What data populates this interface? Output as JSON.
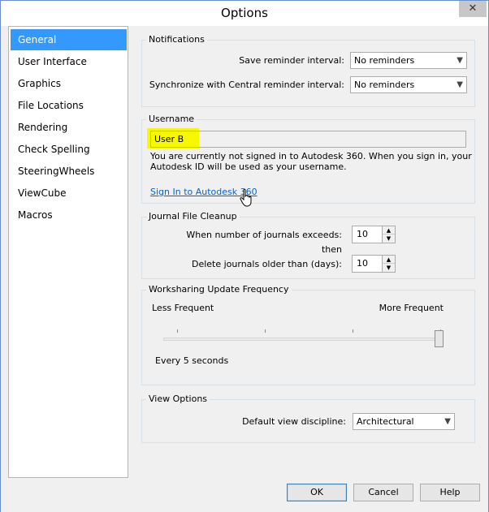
{
  "window": {
    "title": "Options",
    "close_glyph": "✕"
  },
  "sidebar": {
    "items": [
      {
        "label": "General",
        "selected": true
      },
      {
        "label": "User Interface"
      },
      {
        "label": "Graphics"
      },
      {
        "label": "File Locations"
      },
      {
        "label": "Rendering"
      },
      {
        "label": "Check Spelling"
      },
      {
        "label": "SteeringWheels"
      },
      {
        "label": "ViewCube"
      },
      {
        "label": "Macros"
      }
    ]
  },
  "notifications": {
    "title": "Notifications",
    "save_label": "Save reminder interval:",
    "save_value": "No reminders",
    "sync_label": "Synchronize with Central reminder interval:",
    "sync_value": "No reminders"
  },
  "username": {
    "title": "Username",
    "value": "User B",
    "info_line1": "You are currently not signed in to Autodesk 360. When you sign in, your",
    "info_line2": "Autodesk ID will be used as your username.",
    "signin_link": "Sign In to Autodesk 360"
  },
  "journal": {
    "title": "Journal File Cleanup",
    "exceeds_label": "When number of journals exceeds:",
    "exceeds_value": "10",
    "then_label": "then",
    "delete_label": "Delete journals older than (days):",
    "delete_value": "10"
  },
  "worksharing": {
    "title": "Worksharing Update Frequency",
    "less_label": "Less Frequent",
    "more_label": "More Frequent",
    "slider_level": 1.0,
    "status": "Every 5 seconds"
  },
  "view_options": {
    "title": "View Options",
    "discipline_label": "Default view discipline:",
    "discipline_value": "Architectural"
  },
  "buttons": {
    "ok": "OK",
    "cancel": "Cancel",
    "help": "Help"
  },
  "icons": {
    "dropdown_arrow": "▼",
    "spin_up": "▲",
    "spin_down": "▼"
  },
  "colors": {
    "selection": "#3399ff",
    "highlight": "#f7f700",
    "link": "#0066cc"
  }
}
